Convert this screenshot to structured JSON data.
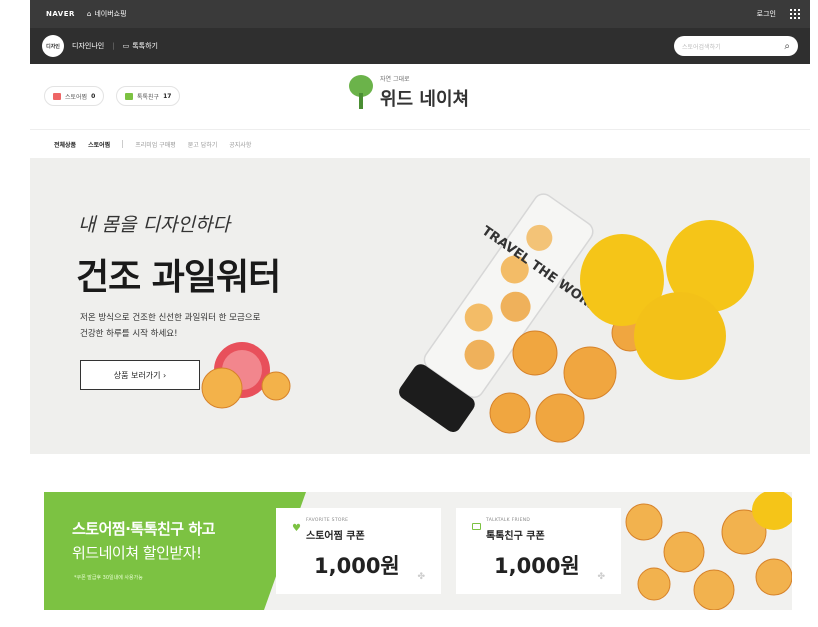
{
  "topbar": {
    "brand": "NAVER",
    "shop_label": "네이버쇼핑",
    "login": "로그인"
  },
  "subbar": {
    "store_avatar": "디자인",
    "store_name": "디자인나인",
    "talk_label": "톡톡하기",
    "search_placeholder": "스토어검색하기"
  },
  "header": {
    "pill_store_label": "스토어찜",
    "pill_store_count": "0",
    "pill_talk_label": "톡톡친구",
    "pill_talk_count": "17",
    "logo_small": "자연 그대로",
    "logo_big": "위드 네이쳐"
  },
  "nav": {
    "items": [
      "전체상품",
      "스토어찜",
      "프리미엄 구매평",
      "묻고 답하기",
      "공지사항"
    ]
  },
  "hero": {
    "script_text": "내 몸을 디자인하다",
    "title": "건조 과일워터",
    "desc_line1": "저온 방식으로 건조한 신선한 과일워터 한 모금으로",
    "desc_line2": "건강한 하루를 시작 하세요!",
    "button": "상품 보러가기 ›",
    "bottle_text": "TRAVEL THE WORLD"
  },
  "coupon_band": {
    "headline_1": "스토어찜·톡톡친구 하고",
    "headline_2": "위드네이쳐 할인받자!",
    "note": "*쿠폰 발급후 30일내에 사용가능",
    "coupons": [
      {
        "label": "FAVORITE STORE",
        "name": "스토어찜 쿠폰",
        "amount": "1,000원"
      },
      {
        "label": "TALKTALK FRIEND",
        "name": "톡톡친구 쿠폰",
        "amount": "1,000원"
      }
    ]
  },
  "colors": {
    "accent_green": "#7cc242",
    "dark_bar": "#3a3a3a",
    "lemon": "#f5c518",
    "orange_slice": "#f0a640"
  }
}
